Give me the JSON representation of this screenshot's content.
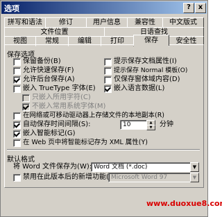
{
  "window": {
    "title": "选项",
    "help_icon": "?",
    "close_icon": "x"
  },
  "tabs_row1": [
    "拼写和语法",
    "修订",
    "用户信息",
    "兼容性",
    "中文版式"
  ],
  "tabs_row2": [
    "文件位置",
    "日语查找"
  ],
  "tabs_row3": [
    "视图",
    "常规",
    "编辑",
    "打印",
    "保存",
    "安全性"
  ],
  "active_tab": "保存",
  "save_options": {
    "heading": "保存选项",
    "left": [
      {
        "label": "保留备份(B)",
        "checked": false,
        "disabled": false
      },
      {
        "label": "允许快速保存(F)",
        "checked": false,
        "disabled": false
      },
      {
        "label": "允许后台保存(A)",
        "checked": true,
        "disabled": false
      },
      {
        "label": "嵌入 TrueType 字体(E)",
        "checked": false,
        "disabled": false
      },
      {
        "label": "只嵌入所用字符(C)",
        "checked": false,
        "disabled": true
      },
      {
        "label": "不嵌入常用系统字体(M)",
        "checked": true,
        "disabled": true
      }
    ],
    "right": [
      {
        "label": "提示保存文档属性(I)",
        "checked": false
      },
      {
        "label": "提示保存 Normal 模板(O)",
        "checked": false
      },
      {
        "label": "仅保存窗体域内容(D)",
        "checked": false
      },
      {
        "label": "嵌入语言数据(L)",
        "checked": true
      }
    ],
    "network_copy": {
      "label": "在网络或可移动驱动器上存储文件的本地副本(R)",
      "checked": false
    },
    "autosave": {
      "label": "自动保存时间间隔(S):",
      "checked": true,
      "minutes": "10",
      "unit": "分钟"
    },
    "smart_tags": {
      "label": "嵌入智能标记(G)",
      "checked": true
    },
    "xml_attr": {
      "label": "在 Web 页中将智能标记存为 XML 属性(Y)",
      "checked": false
    }
  },
  "default_format": {
    "heading": "默认格式",
    "save_as_label": "将 Word 文件保存为(W):",
    "save_as_value": "Word 文档 (*.doc)",
    "disable_label": "禁用在此版本后的新增功能(L):",
    "disable_checked": false,
    "disable_value": "Microsoft Word 97"
  },
  "watermark": "www.duoxue8.com"
}
